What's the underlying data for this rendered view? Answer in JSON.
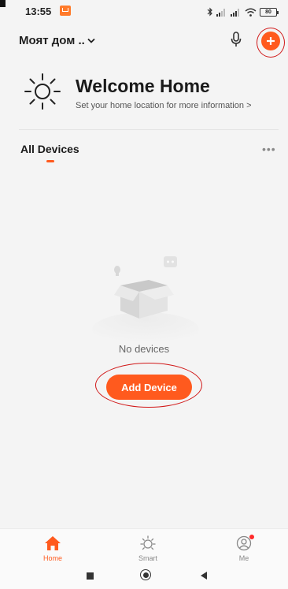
{
  "status_bar": {
    "time": "13:55",
    "battery": "80",
    "icons": [
      "bluetooth-icon",
      "signal-icon",
      "signal-icon",
      "wifi-icon",
      "battery-icon"
    ]
  },
  "header": {
    "home_name": "Моят дом ..",
    "icons": [
      "chevron-down-icon",
      "microphone-icon",
      "plus-icon"
    ],
    "accent_color": "#ff5a1e"
  },
  "welcome": {
    "title": "Welcome Home",
    "subtitle": "Set your home location for more information",
    "icon": "sun-icon"
  },
  "devices": {
    "tab_label": "All Devices",
    "more_icon": "ellipsis-icon",
    "empty_text": "No devices",
    "add_button_label": "Add Device"
  },
  "bottom_nav": {
    "items": [
      {
        "label": "Home",
        "icon": "home-icon",
        "active": true
      },
      {
        "label": "Smart",
        "icon": "sun-icon",
        "active": false
      },
      {
        "label": "Me",
        "icon": "user-icon",
        "active": false
      }
    ]
  },
  "colors": {
    "accent": "#ff5a1e",
    "annotation_ring": "#d11a1a",
    "background": "#f4f4f4"
  }
}
